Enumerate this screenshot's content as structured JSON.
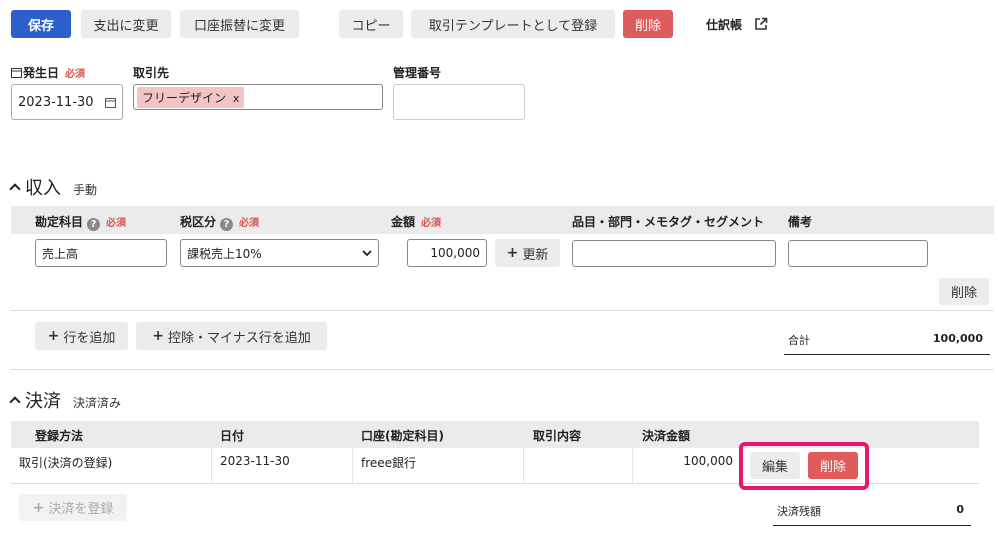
{
  "toolbar": {
    "save": "保存",
    "change_expense": "支出に変更",
    "change_transfer": "口座振替に変更",
    "copy": "コピー",
    "register_template": "取引テンプレートとして登録",
    "delete": "削除",
    "journal": "仕訳帳"
  },
  "header_fields": {
    "date_label": "発生日",
    "required": "必須",
    "date_value": "2023-11-30",
    "partner_label": "取引先",
    "partner_tag": "フリーデザイン",
    "partner_tag_remove": "x",
    "mgmt_label": "管理番号",
    "mgmt_value": ""
  },
  "income": {
    "title": "収入",
    "subtitle": "手動",
    "columns": {
      "account": "勘定科目",
      "tax": "税区分",
      "amount": "金額",
      "items": "品目・部門・メモタグ・セグメント",
      "note": "備考"
    },
    "row": {
      "account": "売上高",
      "tax": "課税売上10%",
      "amount": "100,000",
      "update_button": "更新",
      "items": "",
      "note": ""
    },
    "row_delete": "削除",
    "add_row": "行を追加",
    "add_deduction_row": "控除・マイナス行を追加",
    "total_label": "合計",
    "total_value": "100,000"
  },
  "payment": {
    "title": "決済",
    "subtitle": "決済済み",
    "columns": {
      "method": "登録方法",
      "date": "日付",
      "account": "口座(勘定科目)",
      "content": "取引内容",
      "amount": "決済金額"
    },
    "row": {
      "method": "取引(決済の登録)",
      "date": "2023-11-30",
      "account": "freee銀行",
      "content": "",
      "amount": "100,000",
      "edit": "編集",
      "delete": "削除"
    },
    "register_payment": "決済を登録",
    "balance_label": "決済残額",
    "balance_value": "0"
  },
  "colors": {
    "primary": "#2d5fcc",
    "danger": "#e05b5b",
    "highlight": "#e5186f",
    "required": "#d9534f",
    "tag_bg": "#f2c4c4"
  }
}
